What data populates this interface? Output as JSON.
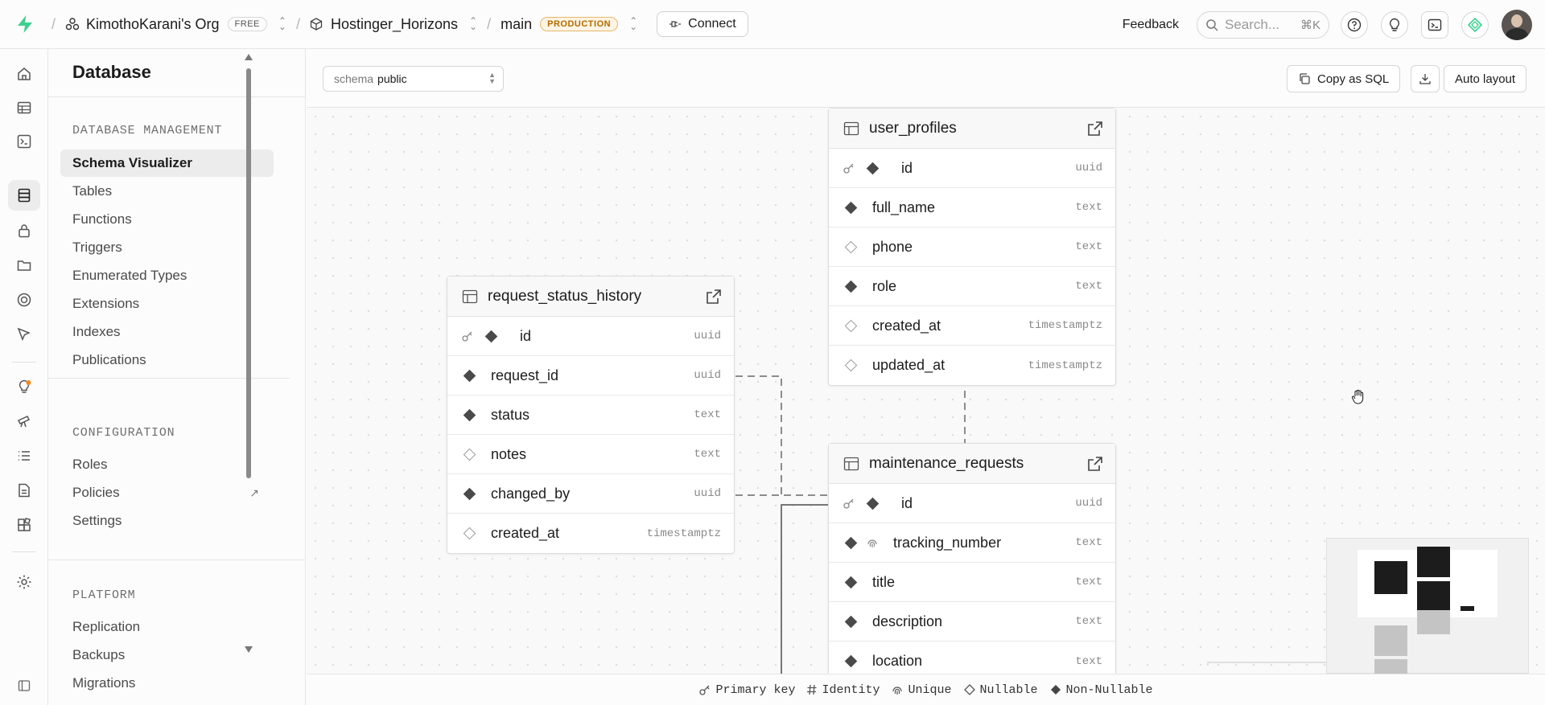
{
  "topbar": {
    "org_name": "KimothoKarani's Org",
    "org_plan": "FREE",
    "project_name": "Hostinger_Horizons",
    "branch_name": "main",
    "branch_env": "PRODUCTION",
    "connect_label": "Connect",
    "feedback_label": "Feedback",
    "search_placeholder": "Search...",
    "search_shortcut": "⌘K"
  },
  "sidebar": {
    "title": "Database",
    "sections": [
      {
        "title": "DATABASE MANAGEMENT",
        "items": [
          {
            "label": "Schema Visualizer"
          },
          {
            "label": "Tables"
          },
          {
            "label": "Functions"
          },
          {
            "label": "Triggers"
          },
          {
            "label": "Enumerated Types"
          },
          {
            "label": "Extensions"
          },
          {
            "label": "Indexes"
          },
          {
            "label": "Publications"
          }
        ]
      },
      {
        "title": "CONFIGURATION",
        "items": [
          {
            "label": "Roles"
          },
          {
            "label": "Policies"
          },
          {
            "label": "Settings"
          }
        ]
      },
      {
        "title": "PLATFORM",
        "items": [
          {
            "label": "Replication"
          },
          {
            "label": "Backups"
          },
          {
            "label": "Migrations"
          }
        ]
      }
    ]
  },
  "toolbar": {
    "schema_prefix": "schema",
    "schema_value": "public",
    "copy_sql_label": "Copy as SQL",
    "auto_layout_label": "Auto layout"
  },
  "tables": [
    {
      "name": "user_profiles",
      "columns": [
        {
          "name": "id",
          "type": "uuid",
          "pk": true,
          "nullable": false
        },
        {
          "name": "full_name",
          "type": "text",
          "pk": false,
          "nullable": false
        },
        {
          "name": "phone",
          "type": "text",
          "pk": false,
          "nullable": true
        },
        {
          "name": "role",
          "type": "text",
          "pk": false,
          "nullable": false
        },
        {
          "name": "created_at",
          "type": "timestamptz",
          "pk": false,
          "nullable": true
        },
        {
          "name": "updated_at",
          "type": "timestamptz",
          "pk": false,
          "nullable": true
        }
      ]
    },
    {
      "name": "request_status_history",
      "columns": [
        {
          "name": "id",
          "type": "uuid",
          "pk": true,
          "nullable": false
        },
        {
          "name": "request_id",
          "type": "uuid",
          "pk": false,
          "nullable": false
        },
        {
          "name": "status",
          "type": "text",
          "pk": false,
          "nullable": false
        },
        {
          "name": "notes",
          "type": "text",
          "pk": false,
          "nullable": true
        },
        {
          "name": "changed_by",
          "type": "uuid",
          "pk": false,
          "nullable": false
        },
        {
          "name": "created_at",
          "type": "timestamptz",
          "pk": false,
          "nullable": true
        }
      ]
    },
    {
      "name": "maintenance_requests",
      "columns": [
        {
          "name": "id",
          "type": "uuid",
          "pk": true,
          "nullable": false
        },
        {
          "name": "tracking_number",
          "type": "text",
          "pk": false,
          "nullable": false,
          "unique": true
        },
        {
          "name": "title",
          "type": "text",
          "pk": false,
          "nullable": false
        },
        {
          "name": "description",
          "type": "text",
          "pk": false,
          "nullable": false
        },
        {
          "name": "location",
          "type": "text",
          "pk": false,
          "nullable": false
        }
      ]
    }
  ],
  "legend": {
    "primary_key": "Primary key",
    "identity": "Identity",
    "unique": "Unique",
    "nullable": "Nullable",
    "non_nullable": "Non-Nullable"
  },
  "colors": {
    "brand_green": "#3ecf8e",
    "production_badge": "#b36b00",
    "notification_dot": "#f08a24"
  }
}
